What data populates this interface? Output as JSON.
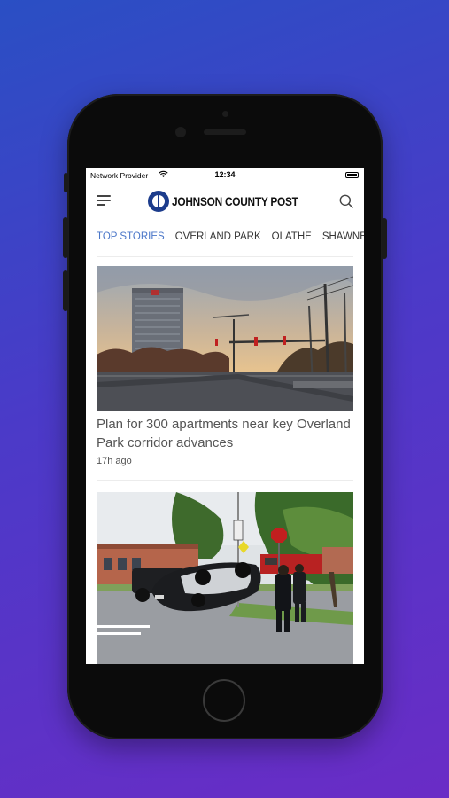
{
  "status_bar": {
    "provider": "Network Provider",
    "time": "12:34"
  },
  "header": {
    "logo_text": "JOHNSON COUNTY POST"
  },
  "tabs": [
    {
      "label": "TOP STORIES",
      "active": true
    },
    {
      "label": "OVERLAND PARK",
      "active": false
    },
    {
      "label": "OLATHE",
      "active": false
    },
    {
      "label": "SHAWNEE",
      "active": false
    }
  ],
  "stories": [
    {
      "title": "Plan for 300 apartments near key Overland Park corridor advances",
      "time": "17h ago"
    }
  ],
  "colors": {
    "accent": "#4a76c8",
    "background_top": "#2a4fc4",
    "background_bottom": "#6a2cc6"
  }
}
